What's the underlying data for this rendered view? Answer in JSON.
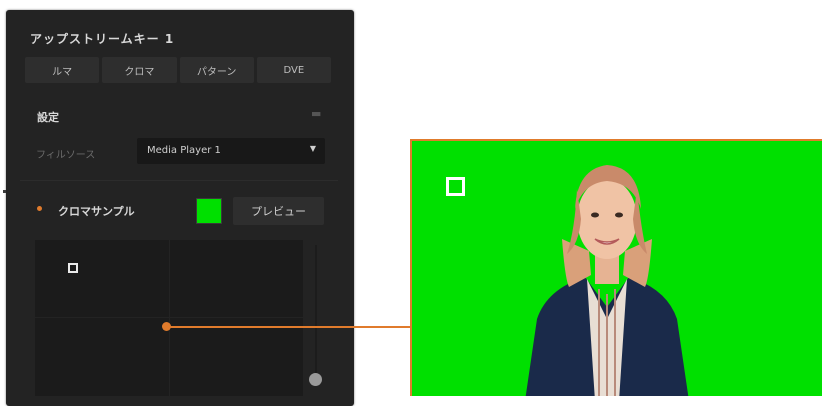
{
  "panel": {
    "title": "アップストリームキー 1",
    "tabs": [
      "ルマ",
      "クロマ",
      "パターン",
      "DVE"
    ],
    "section_label": "設定",
    "fill_source_label": "フィルソース",
    "fill_source_value": "Media Player 1",
    "chroma_sample_label": "クロマサンプル",
    "preview_label": "プレビュー"
  },
  "colors": {
    "accent": "#e07b2c",
    "key_green": "#00e000",
    "panel_bg": "#232323"
  },
  "icons": [
    "chevron-down-icon",
    "collapse-icon",
    "sample-marker-icon"
  ]
}
